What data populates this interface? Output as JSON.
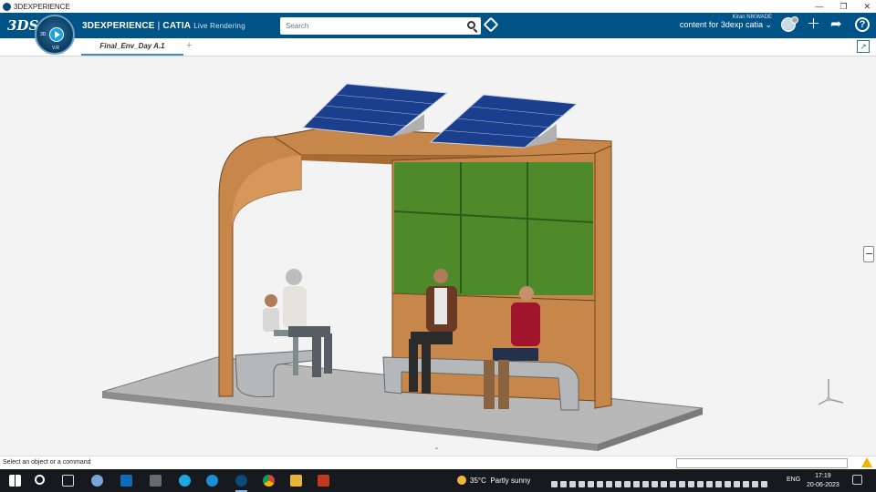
{
  "window": {
    "title": "3DEXPERIENCE"
  },
  "header": {
    "logo": "3DS",
    "compass": {
      "label": "3D",
      "version": "V.R"
    },
    "brand_bold": "3DEXPERIENCE",
    "brand_sep": " | ",
    "brand_app": "CATIA",
    "brand_sub": "Live Rendering",
    "search_placeholder": "Search",
    "user_name": "Kiran NIKWADE",
    "context": "content for 3dexp catia ⌄"
  },
  "tabs": [
    {
      "label": "Final_Env_Day A.1"
    }
  ],
  "status": {
    "message": "Select an object or a command"
  },
  "taskbar": {
    "weather_temp": "35°C",
    "weather_desc": "Partly sunny",
    "language": "ENG",
    "time": "17:19",
    "date": "20-06-2023"
  },
  "icons": [
    "search-icon",
    "tag-icon",
    "plus-icon",
    "share-icon",
    "help-icon",
    "expand-icon",
    "windows-start-icon",
    "taskbar-search-icon"
  ],
  "colors": {
    "topbar": "#005386",
    "panel_wood": "#c8874a",
    "solar": "#1b3f8c",
    "green_wall": "#4f8a2a"
  }
}
